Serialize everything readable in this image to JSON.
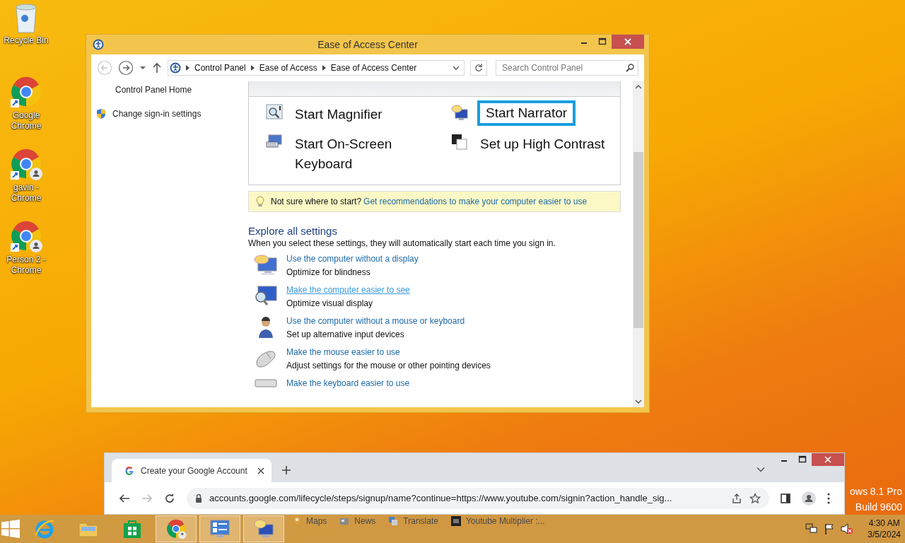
{
  "desktop_icons": [
    {
      "label": "Recycle Bin",
      "kind": "bin"
    },
    {
      "label": "Google Chrome",
      "kind": "chrome"
    },
    {
      "label": "gavin - Chrome",
      "kind": "chrome-profile"
    },
    {
      "label": "Person 2 - Chrome",
      "kind": "chrome-profile"
    }
  ],
  "window": {
    "title": "Ease of Access Center",
    "breadcrumb": [
      "Control Panel",
      "Ease of Access",
      "Ease of Access Center"
    ],
    "search": {
      "placeholder": "Search Control Panel"
    },
    "sidebar": {
      "items": [
        {
          "label": "Control Panel Home",
          "kind": "plain"
        },
        {
          "label": "Change sign-in settings",
          "kind": "shield"
        }
      ]
    },
    "quick_access": [
      {
        "label": "Start Magnifier",
        "kind": "magnifier",
        "focused": false
      },
      {
        "label": "Start Narrator",
        "kind": "narrator",
        "focused": true
      },
      {
        "label": "Start On-Screen Keyboard",
        "kind": "keyboard",
        "focused": false
      },
      {
        "label": "Set up High Contrast",
        "kind": "contrast",
        "focused": false
      }
    ],
    "tip": {
      "text": "Not sure where to start?",
      "link": "Get recommendations to make your computer easier to use"
    },
    "explore": {
      "heading": "Explore all settings",
      "description": "When you select these settings, they will automatically start each time you sign in.",
      "items": [
        {
          "link": "Use the computer without a display",
          "description": "Optimize for blindness",
          "kind": "display",
          "hovered": false
        },
        {
          "link": "Make the computer easier to see",
          "description": "Optimize visual display",
          "kind": "see",
          "hovered": true
        },
        {
          "link": "Use the computer without a mouse or keyboard",
          "description": "Set up alternative input devices",
          "kind": "person",
          "hovered": false
        },
        {
          "link": "Make the mouse easier to use",
          "description": "Adjust settings for the mouse or other pointing devices",
          "kind": "mouse",
          "hovered": false
        },
        {
          "link": "Make the keyboard easier to use",
          "kind": "keyboard",
          "hovered": false
        }
      ]
    }
  },
  "browser": {
    "tab": {
      "title": "Create your Google Account"
    },
    "url": "accounts.google.com/lifecycle/steps/signup/name?continue=https://www.youtube.com/signin?action_handle_sig...",
    "bookmarks": [
      {
        "label": "Maps",
        "kind": "maps"
      },
      {
        "label": "News",
        "kind": "news"
      },
      {
        "label": "Translate",
        "kind": "translate"
      },
      {
        "label": "Youtube Multiplier :...",
        "kind": "page"
      }
    ]
  },
  "desktop_text": [
    "ows 8.1 Pro",
    "Build 9600"
  ],
  "taskbar": {
    "apps": [
      {
        "kind": "ie",
        "open": false
      },
      {
        "kind": "explorer",
        "open": false
      },
      {
        "kind": "store",
        "open": false
      },
      {
        "kind": "chrome",
        "open": true
      },
      {
        "kind": "control-panel",
        "open": true
      },
      {
        "kind": "narrator",
        "open": true
      }
    ],
    "clock": {
      "time": "4:30 AM",
      "date": "3/5/2024"
    }
  }
}
